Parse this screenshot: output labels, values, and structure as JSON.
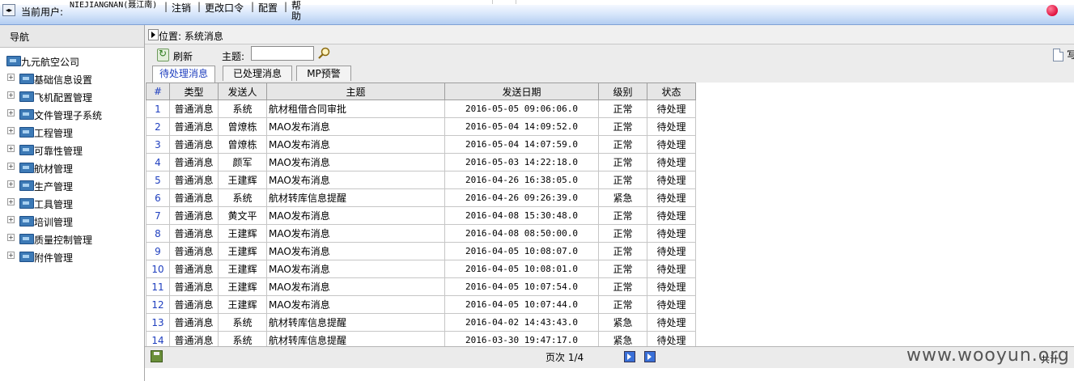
{
  "header": {
    "current_user_label": "当前用户:",
    "user_name": "NIEJIANGNAN(聂江南)",
    "menu": [
      {
        "label": "注销"
      },
      {
        "label": "更改口令"
      },
      {
        "label": "配置"
      },
      {
        "label": "帮助"
      }
    ],
    "separator": "|",
    "colors": {
      "bar_top": "#f4f8ff",
      "bar_bottom": "#b3cdf1",
      "record_dot": "#e0103d"
    }
  },
  "nav": {
    "title": "导航",
    "root": "九元航空公司",
    "items": [
      {
        "label": "基础信息设置"
      },
      {
        "label": "飞机配置管理"
      },
      {
        "label": "文件管理子系统"
      },
      {
        "label": "工程管理"
      },
      {
        "label": "可靠性管理"
      },
      {
        "label": "航材管理"
      },
      {
        "label": "生产管理"
      },
      {
        "label": "工具管理"
      },
      {
        "label": "培训管理"
      },
      {
        "label": "质量控制管理"
      },
      {
        "label": "附件管理"
      }
    ],
    "expander_symbol": "+",
    "folder_icon": "folder-icon"
  },
  "location": {
    "text": "位置: 系统消息"
  },
  "toolbar": {
    "refresh_label": "刷新",
    "subject_label": "主题:",
    "subject_value": "",
    "right_char": "写"
  },
  "tabs": [
    {
      "label": "待处理消息",
      "active": true
    },
    {
      "label": "已处理消息",
      "active": false
    },
    {
      "label": "MP预警",
      "active": false
    }
  ],
  "table": {
    "columns": [
      "#",
      "类型",
      "发送人",
      "主题",
      "发送日期",
      "级别",
      "状态"
    ],
    "rows": [
      [
        "1",
        "普通消息",
        "系统",
        "航材租借合同审批",
        "2016-05-05 09:06:06.0",
        "正常",
        "待处理"
      ],
      [
        "2",
        "普通消息",
        "曾燎栋",
        "MAO发布消息",
        "2016-05-04 14:09:52.0",
        "正常",
        "待处理"
      ],
      [
        "3",
        "普通消息",
        "曾燎栋",
        "MAO发布消息",
        "2016-05-04 14:07:59.0",
        "正常",
        "待处理"
      ],
      [
        "4",
        "普通消息",
        "颜军",
        "MAO发布消息",
        "2016-05-03 14:22:18.0",
        "正常",
        "待处理"
      ],
      [
        "5",
        "普通消息",
        "王建辉",
        "MAO发布消息",
        "2016-04-26 16:38:05.0",
        "正常",
        "待处理"
      ],
      [
        "6",
        "普通消息",
        "系统",
        "航材转库信息提醒",
        "2016-04-26 09:26:39.0",
        "紧急",
        "待处理"
      ],
      [
        "7",
        "普通消息",
        "黄文平",
        "MAO发布消息",
        "2016-04-08 15:30:48.0",
        "正常",
        "待处理"
      ],
      [
        "8",
        "普通消息",
        "王建辉",
        "MAO发布消息",
        "2016-04-08 08:50:00.0",
        "正常",
        "待处理"
      ],
      [
        "9",
        "普通消息",
        "王建辉",
        "MAO发布消息",
        "2016-04-05 10:08:07.0",
        "正常",
        "待处理"
      ],
      [
        "10",
        "普通消息",
        "王建辉",
        "MAO发布消息",
        "2016-04-05 10:08:01.0",
        "正常",
        "待处理"
      ],
      [
        "11",
        "普通消息",
        "王建辉",
        "MAO发布消息",
        "2016-04-05 10:07:54.0",
        "正常",
        "待处理"
      ],
      [
        "12",
        "普通消息",
        "王建辉",
        "MAO发布消息",
        "2016-04-05 10:07:44.0",
        "正常",
        "待处理"
      ],
      [
        "13",
        "普通消息",
        "系统",
        "航材转库信息提醒",
        "2016-04-02 14:43:43.0",
        "紧急",
        "待处理"
      ],
      [
        "14",
        "普通消息",
        "系统",
        "航材转库信息提醒",
        "2016-03-30 19:47:17.0",
        "紧急",
        "待处理"
      ]
    ]
  },
  "footer": {
    "page_text": "页次 1/4",
    "total_text": "共计",
    "watermark": "www.wooyun.org"
  }
}
